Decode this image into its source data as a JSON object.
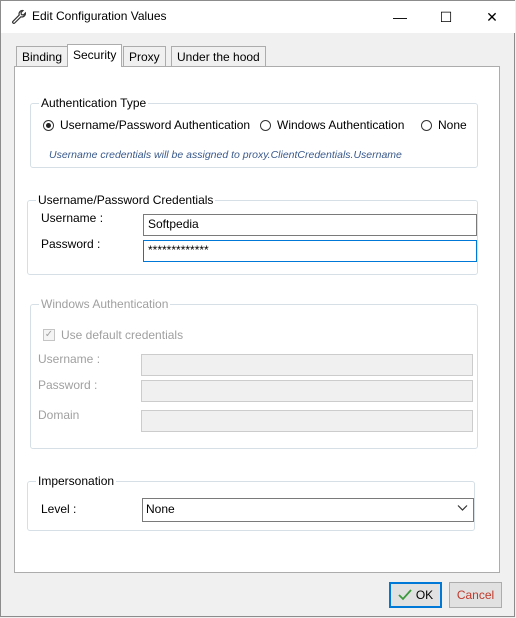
{
  "window": {
    "title": "Edit Configuration Values",
    "icon": "wrench-icon"
  },
  "titlebar_controls": {
    "minimize": "—",
    "maximize": "☐",
    "close": "✕"
  },
  "tabs": [
    {
      "label": "Binding",
      "active": false
    },
    {
      "label": "Security",
      "active": true
    },
    {
      "label": "Proxy",
      "active": false
    },
    {
      "label": "Under the hood",
      "active": false
    }
  ],
  "auth_type": {
    "legend": "Authentication Type",
    "options": [
      {
        "label": "Username/Password Authentication",
        "selected": true
      },
      {
        "label": "Windows Authentication",
        "selected": false
      },
      {
        "label": "None",
        "selected": false
      }
    ],
    "hint": "Username credentials will be assigned to proxy.ClientCredentials.Username"
  },
  "credentials": {
    "legend": "Username/Password Credentials",
    "username_label": "Username :",
    "username_value": "Softpedia",
    "password_label": "Password :",
    "password_value": "*************"
  },
  "windows_auth": {
    "legend": "Windows Authentication",
    "default_label": "Use default credentials",
    "default_checked": true,
    "username_label": "Username :",
    "password_label": "Password :",
    "domain_label": "Domain"
  },
  "impersonation": {
    "legend": "Impersonation",
    "level_label": "Level :",
    "level_value": "None"
  },
  "buttons": {
    "ok": "OK",
    "cancel": "Cancel"
  },
  "colors": {
    "accent": "#0078d7",
    "ok_check": "#3c9a3c",
    "cancel_text": "#c0392b",
    "hint": "#3a5a8c"
  }
}
